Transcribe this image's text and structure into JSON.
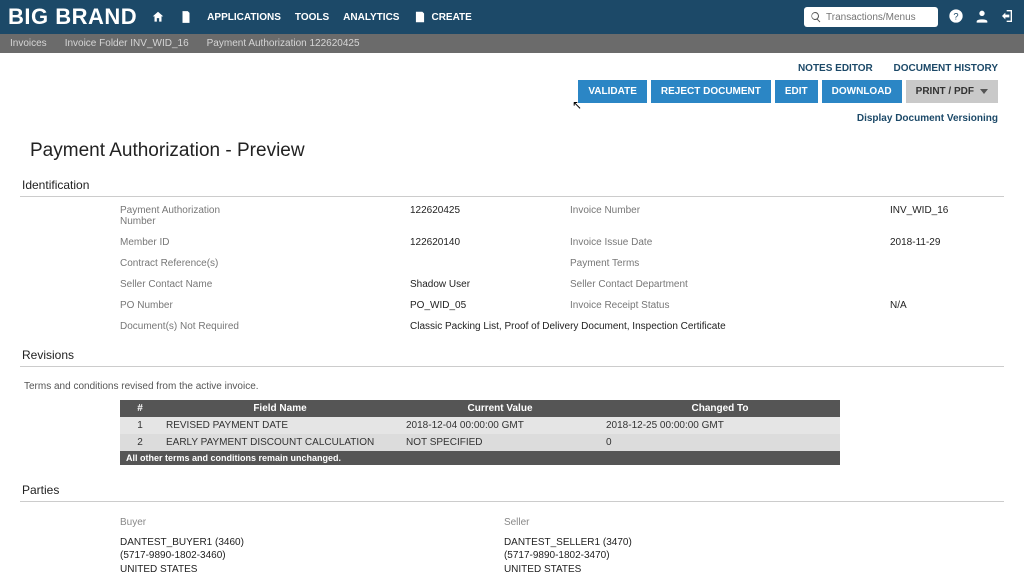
{
  "brand": "BIG BRAND",
  "nav": {
    "home": "",
    "doc": "",
    "applications": "APPLICATIONS",
    "tools": "TOOLS",
    "analytics": "ANALYTICS",
    "create": "CREATE"
  },
  "search": {
    "placeholder": "Transactions/Menus"
  },
  "breadcrumb": {
    "a": "Invoices",
    "b": "Invoice Folder INV_WID_16",
    "c": "Payment Authorization 122620425"
  },
  "topLinks": {
    "notes": "NOTES EDITOR",
    "history": "DOCUMENT HISTORY"
  },
  "actions": {
    "validate": "VALIDATE",
    "reject": "REJECT DOCUMENT",
    "edit": "EDIT",
    "download": "DOWNLOAD",
    "print": "PRINT / PDF"
  },
  "versioning": "Display Document Versioning",
  "title": "Payment Authorization - Preview",
  "sections": {
    "identification": "Identification",
    "revisions": "Revisions",
    "parties": "Parties"
  },
  "id": {
    "panLabel": "Payment Authorization Number",
    "panValue": "122620425",
    "invNumLabel": "Invoice Number",
    "invNumValue": "INV_WID_16",
    "memberLabel": "Member ID",
    "memberValue": "122620140",
    "issueLabel": "Invoice Issue Date",
    "issueValue": "2018-11-29",
    "contractLabel": "Contract Reference(s)",
    "contractValue": "",
    "termsLabel": "Payment Terms",
    "termsValue": "",
    "sellerNameLabel": "Seller Contact Name",
    "sellerNameValue": "Shadow User",
    "sellerDeptLabel": "Seller Contact Department",
    "sellerDeptValue": "",
    "poLabel": "PO Number",
    "poValue": "PO_WID_05",
    "receiptLabel": "Invoice Receipt Status",
    "receiptValue": "N/A",
    "docsLabel": "Document(s) Not Required",
    "docsValue": "Classic Packing List, Proof of Delivery Document, Inspection Certificate"
  },
  "revisions": {
    "note": "Terms and conditions revised from the active invoice.",
    "headers": {
      "num": "#",
      "field": "Field Name",
      "current": "Current Value",
      "changed": "Changed To"
    },
    "rows": [
      {
        "num": "1",
        "field": "REVISED PAYMENT DATE",
        "current": "2018-12-04 00:00:00 GMT",
        "changed": "2018-12-25 00:00:00 GMT"
      },
      {
        "num": "2",
        "field": "EARLY PAYMENT DISCOUNT CALCULATION",
        "current": "NOT SPECIFIED",
        "changed": "0"
      }
    ],
    "footer": "All other terms and conditions remain unchanged."
  },
  "parties": {
    "buyer": {
      "title": "Buyer",
      "name": "DANTEST_BUYER1 (3460)",
      "id": "(5717-9890-1802-3460)",
      "country": "UNITED STATES"
    },
    "seller": {
      "title": "Seller",
      "name": "DANTEST_SELLER1 (3470)",
      "id": "(5717-9890-1802-3470)",
      "country": "UNITED STATES"
    }
  }
}
